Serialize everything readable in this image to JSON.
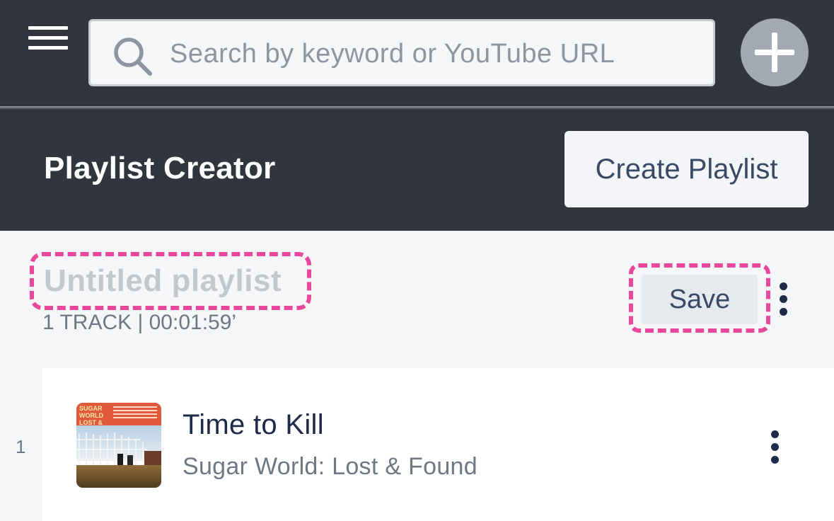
{
  "topbar": {
    "menu_icon": "hamburger-menu-icon",
    "search": {
      "icon": "search-icon",
      "placeholder": "Search by keyword or YouTube URL",
      "value": ""
    },
    "add_icon": "plus-icon"
  },
  "header": {
    "title": "Playlist Creator",
    "create_button_label": "Create Playlist"
  },
  "playlist": {
    "name": "Untitled playlist",
    "meta": "1 TRACK | 00:01:59’",
    "save_label": "Save",
    "more_icon": "more-vertical-icon"
  },
  "tracks": [
    {
      "number": "1",
      "title": "Time to Kill",
      "artist": "Sugar World: Lost & Found",
      "cover_text": "SUGAR WORLD LOST & FOUND",
      "more_icon": "more-vertical-icon"
    }
  ],
  "colors": {
    "topbar_bg": "#31363e",
    "accent_dashed": "#e8489c",
    "text_primary": "#1e2b48",
    "text_secondary": "#6f7785",
    "panel_bg": "#f4f6f8"
  }
}
